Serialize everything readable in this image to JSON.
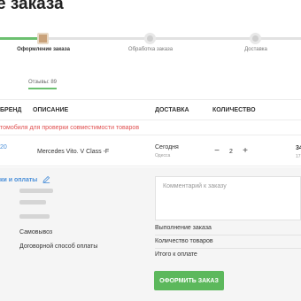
{
  "page": {
    "title": "е заказа"
  },
  "stepper": {
    "steps": [
      {
        "label": "Оформление заказа",
        "active": true
      },
      {
        "label": "Обработка заказа",
        "active": false
      },
      {
        "label": "Доставка",
        "active": false
      }
    ],
    "progress_fraction": 0.15
  },
  "rating": {
    "label": "Отзывы: 89"
  },
  "table": {
    "headers": {
      "brand": "БРЕНД",
      "description": "ОПИСАНИЕ",
      "delivery": "ДОСТАВКА",
      "quantity": "КОЛИЧЕСТВО"
    },
    "warning": "томобиля для проверки совместимости товаров",
    "rows": [
      {
        "code": "20",
        "name": "Mercedes Vito. V Class -F",
        "delivery": "Сегодня",
        "delivery_sub": "Одесса",
        "quantity": "2",
        "qty_minus": "−",
        "qty_plus": "+",
        "price": "34",
        "price_sub": "17"
      }
    ]
  },
  "payment": {
    "section_title": "ки и оплаты",
    "delivery_method": "Самовывоз",
    "payment_method": "Договорной способ оплаты"
  },
  "summary": {
    "comment_placeholder": "Комментарий к заказу",
    "lines": {
      "fulfillment": "Выполнение заказа",
      "item_count": "Количество товаров",
      "total": "Итого к оплате"
    },
    "submit_label": "ОФОРМИТЬ ЗАКАЗ"
  },
  "colors": {
    "accent_green": "#5cb85c",
    "link_blue": "#4a8fd9",
    "warning_red": "#e05050",
    "step_active": "#c9a27a"
  },
  "icons": {
    "edit": "pencil-icon"
  }
}
